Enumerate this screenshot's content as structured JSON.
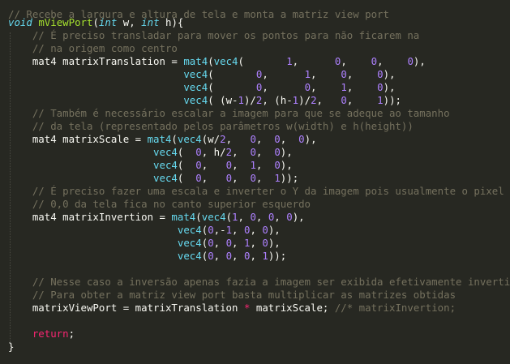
{
  "theme": {
    "background": "#272822",
    "comment": "#75715e",
    "keyword": "#66d9ef",
    "function": "#a6e22e",
    "number": "#ae81ff",
    "return": "#f92672",
    "text": "#f8f8f2"
  },
  "lines": [
    [
      {
        "t": "// Recebe a largura e altura de tela e monta a matriz view port",
        "c": "comment"
      }
    ],
    [
      {
        "t": "void",
        "c": "kw"
      },
      {
        "t": " ",
        "c": "plain"
      },
      {
        "t": "mViewPort",
        "c": "fn"
      },
      {
        "t": "(",
        "c": "plain"
      },
      {
        "t": "int",
        "c": "kw"
      },
      {
        "t": " w, ",
        "c": "plain"
      },
      {
        "t": "int",
        "c": "kw"
      },
      {
        "t": " h){",
        "c": "plain"
      }
    ],
    [
      {
        "t": "    // É preciso transladar para mover os pontos para não ficarem na",
        "c": "comment"
      }
    ],
    [
      {
        "t": "    // na origem como centro",
        "c": "comment"
      }
    ],
    [
      {
        "t": "    mat4 matrixTranslation = ",
        "c": "plain"
      },
      {
        "t": "mat4",
        "c": "call"
      },
      {
        "t": "(",
        "c": "plain"
      },
      {
        "t": "vec4",
        "c": "call"
      },
      {
        "t": "(       ",
        "c": "plain"
      },
      {
        "t": "1",
        "c": "num"
      },
      {
        "t": ",      ",
        "c": "plain"
      },
      {
        "t": "0",
        "c": "num"
      },
      {
        "t": ",    ",
        "c": "plain"
      },
      {
        "t": "0",
        "c": "num"
      },
      {
        "t": ",    ",
        "c": "plain"
      },
      {
        "t": "0",
        "c": "num"
      },
      {
        "t": "),",
        "c": "plain"
      }
    ],
    [
      {
        "t": "                             ",
        "c": "plain"
      },
      {
        "t": "vec4",
        "c": "call"
      },
      {
        "t": "(       ",
        "c": "plain"
      },
      {
        "t": "0",
        "c": "num"
      },
      {
        "t": ",      ",
        "c": "plain"
      },
      {
        "t": "1",
        "c": "num"
      },
      {
        "t": ",    ",
        "c": "plain"
      },
      {
        "t": "0",
        "c": "num"
      },
      {
        "t": ",    ",
        "c": "plain"
      },
      {
        "t": "0",
        "c": "num"
      },
      {
        "t": "),",
        "c": "plain"
      }
    ],
    [
      {
        "t": "                             ",
        "c": "plain"
      },
      {
        "t": "vec4",
        "c": "call"
      },
      {
        "t": "(       ",
        "c": "plain"
      },
      {
        "t": "0",
        "c": "num"
      },
      {
        "t": ",      ",
        "c": "plain"
      },
      {
        "t": "0",
        "c": "num"
      },
      {
        "t": ",    ",
        "c": "plain"
      },
      {
        "t": "1",
        "c": "num"
      },
      {
        "t": ",    ",
        "c": "plain"
      },
      {
        "t": "0",
        "c": "num"
      },
      {
        "t": "),",
        "c": "plain"
      }
    ],
    [
      {
        "t": "                             ",
        "c": "plain"
      },
      {
        "t": "vec4",
        "c": "call"
      },
      {
        "t": "( (w-",
        "c": "plain"
      },
      {
        "t": "1",
        "c": "num"
      },
      {
        "t": ")/",
        "c": "plain"
      },
      {
        "t": "2",
        "c": "num"
      },
      {
        "t": ", (h-",
        "c": "plain"
      },
      {
        "t": "1",
        "c": "num"
      },
      {
        "t": ")/",
        "c": "plain"
      },
      {
        "t": "2",
        "c": "num"
      },
      {
        "t": ",   ",
        "c": "plain"
      },
      {
        "t": "0",
        "c": "num"
      },
      {
        "t": ",    ",
        "c": "plain"
      },
      {
        "t": "1",
        "c": "num"
      },
      {
        "t": "));",
        "c": "plain"
      }
    ],
    [
      {
        "t": "    // Também é necessário escalar a imagem para que se adeque ao tamanho",
        "c": "comment"
      }
    ],
    [
      {
        "t": "    // da tela (representado pelos parâmetros w(width) e h(height))",
        "c": "comment"
      }
    ],
    [
      {
        "t": "    mat4 matrixScale = ",
        "c": "plain"
      },
      {
        "t": "mat4",
        "c": "call"
      },
      {
        "t": "(",
        "c": "plain"
      },
      {
        "t": "vec4",
        "c": "call"
      },
      {
        "t": "(w/",
        "c": "plain"
      },
      {
        "t": "2",
        "c": "num"
      },
      {
        "t": ",   ",
        "c": "plain"
      },
      {
        "t": "0",
        "c": "num"
      },
      {
        "t": ",  ",
        "c": "plain"
      },
      {
        "t": "0",
        "c": "num"
      },
      {
        "t": ",  ",
        "c": "plain"
      },
      {
        "t": "0",
        "c": "num"
      },
      {
        "t": "),",
        "c": "plain"
      }
    ],
    [
      {
        "t": "                        ",
        "c": "plain"
      },
      {
        "t": "vec4",
        "c": "call"
      },
      {
        "t": "(  ",
        "c": "plain"
      },
      {
        "t": "0",
        "c": "num"
      },
      {
        "t": ", h/",
        "c": "plain"
      },
      {
        "t": "2",
        "c": "num"
      },
      {
        "t": ",  ",
        "c": "plain"
      },
      {
        "t": "0",
        "c": "num"
      },
      {
        "t": ",  ",
        "c": "plain"
      },
      {
        "t": "0",
        "c": "num"
      },
      {
        "t": "),",
        "c": "plain"
      }
    ],
    [
      {
        "t": "                        ",
        "c": "plain"
      },
      {
        "t": "vec4",
        "c": "call"
      },
      {
        "t": "(  ",
        "c": "plain"
      },
      {
        "t": "0",
        "c": "num"
      },
      {
        "t": ",   ",
        "c": "plain"
      },
      {
        "t": "0",
        "c": "num"
      },
      {
        "t": ",  ",
        "c": "plain"
      },
      {
        "t": "1",
        "c": "num"
      },
      {
        "t": ",  ",
        "c": "plain"
      },
      {
        "t": "0",
        "c": "num"
      },
      {
        "t": "),",
        "c": "plain"
      }
    ],
    [
      {
        "t": "                        ",
        "c": "plain"
      },
      {
        "t": "vec4",
        "c": "call"
      },
      {
        "t": "(  ",
        "c": "plain"
      },
      {
        "t": "0",
        "c": "num"
      },
      {
        "t": ",   ",
        "c": "plain"
      },
      {
        "t": "0",
        "c": "num"
      },
      {
        "t": ",  ",
        "c": "plain"
      },
      {
        "t": "0",
        "c": "num"
      },
      {
        "t": ",  ",
        "c": "plain"
      },
      {
        "t": "1",
        "c": "num"
      },
      {
        "t": "));",
        "c": "plain"
      }
    ],
    [
      {
        "t": "    // É preciso fazer uma escala e inverter o Y da imagem pois usualmente o pixel",
        "c": "comment"
      }
    ],
    [
      {
        "t": "    // 0,0 da tela fica no canto superior esquerdo",
        "c": "comment"
      }
    ],
    [
      {
        "t": "    mat4 matrixInvertion = ",
        "c": "plain"
      },
      {
        "t": "mat4",
        "c": "call"
      },
      {
        "t": "(",
        "c": "plain"
      },
      {
        "t": "vec4",
        "c": "call"
      },
      {
        "t": "(",
        "c": "plain"
      },
      {
        "t": "1",
        "c": "num"
      },
      {
        "t": ", ",
        "c": "plain"
      },
      {
        "t": "0",
        "c": "num"
      },
      {
        "t": ", ",
        "c": "plain"
      },
      {
        "t": "0",
        "c": "num"
      },
      {
        "t": ", ",
        "c": "plain"
      },
      {
        "t": "0",
        "c": "num"
      },
      {
        "t": "),",
        "c": "plain"
      }
    ],
    [
      {
        "t": "                            ",
        "c": "plain"
      },
      {
        "t": "vec4",
        "c": "call"
      },
      {
        "t": "(",
        "c": "plain"
      },
      {
        "t": "0",
        "c": "num"
      },
      {
        "t": ",-",
        "c": "plain"
      },
      {
        "t": "1",
        "c": "num"
      },
      {
        "t": ", ",
        "c": "plain"
      },
      {
        "t": "0",
        "c": "num"
      },
      {
        "t": ", ",
        "c": "plain"
      },
      {
        "t": "0",
        "c": "num"
      },
      {
        "t": "),",
        "c": "plain"
      }
    ],
    [
      {
        "t": "                            ",
        "c": "plain"
      },
      {
        "t": "vec4",
        "c": "call"
      },
      {
        "t": "(",
        "c": "plain"
      },
      {
        "t": "0",
        "c": "num"
      },
      {
        "t": ", ",
        "c": "plain"
      },
      {
        "t": "0",
        "c": "num"
      },
      {
        "t": ", ",
        "c": "plain"
      },
      {
        "t": "1",
        "c": "num"
      },
      {
        "t": ", ",
        "c": "plain"
      },
      {
        "t": "0",
        "c": "num"
      },
      {
        "t": "),",
        "c": "plain"
      }
    ],
    [
      {
        "t": "                            ",
        "c": "plain"
      },
      {
        "t": "vec4",
        "c": "call"
      },
      {
        "t": "(",
        "c": "plain"
      },
      {
        "t": "0",
        "c": "num"
      },
      {
        "t": ", ",
        "c": "plain"
      },
      {
        "t": "0",
        "c": "num"
      },
      {
        "t": ", ",
        "c": "plain"
      },
      {
        "t": "0",
        "c": "num"
      },
      {
        "t": ", ",
        "c": "plain"
      },
      {
        "t": "1",
        "c": "num"
      },
      {
        "t": "));",
        "c": "plain"
      }
    ],
    [
      {
        "t": "",
        "c": "plain"
      }
    ],
    [
      {
        "t": "    // Nesse caso a inversão apenas fazia a imagem ser exibida efetivamente invertida",
        "c": "comment"
      }
    ],
    [
      {
        "t": "    // Para obter a matriz view port basta multiplicar as matrizes obtidas",
        "c": "comment"
      }
    ],
    [
      {
        "t": "    matrixViewPort = matrixTranslation ",
        "c": "plain"
      },
      {
        "t": "*",
        "c": "op"
      },
      {
        "t": " matrixScale; ",
        "c": "plain"
      },
      {
        "t": "//* matrixInvertion;",
        "c": "comment"
      }
    ],
    [
      {
        "t": "",
        "c": "plain"
      }
    ],
    [
      {
        "t": "    ",
        "c": "plain"
      },
      {
        "t": "return",
        "c": "ret"
      },
      {
        "t": ";",
        "c": "plain"
      }
    ],
    [
      {
        "t": "}",
        "c": "plain"
      }
    ]
  ]
}
